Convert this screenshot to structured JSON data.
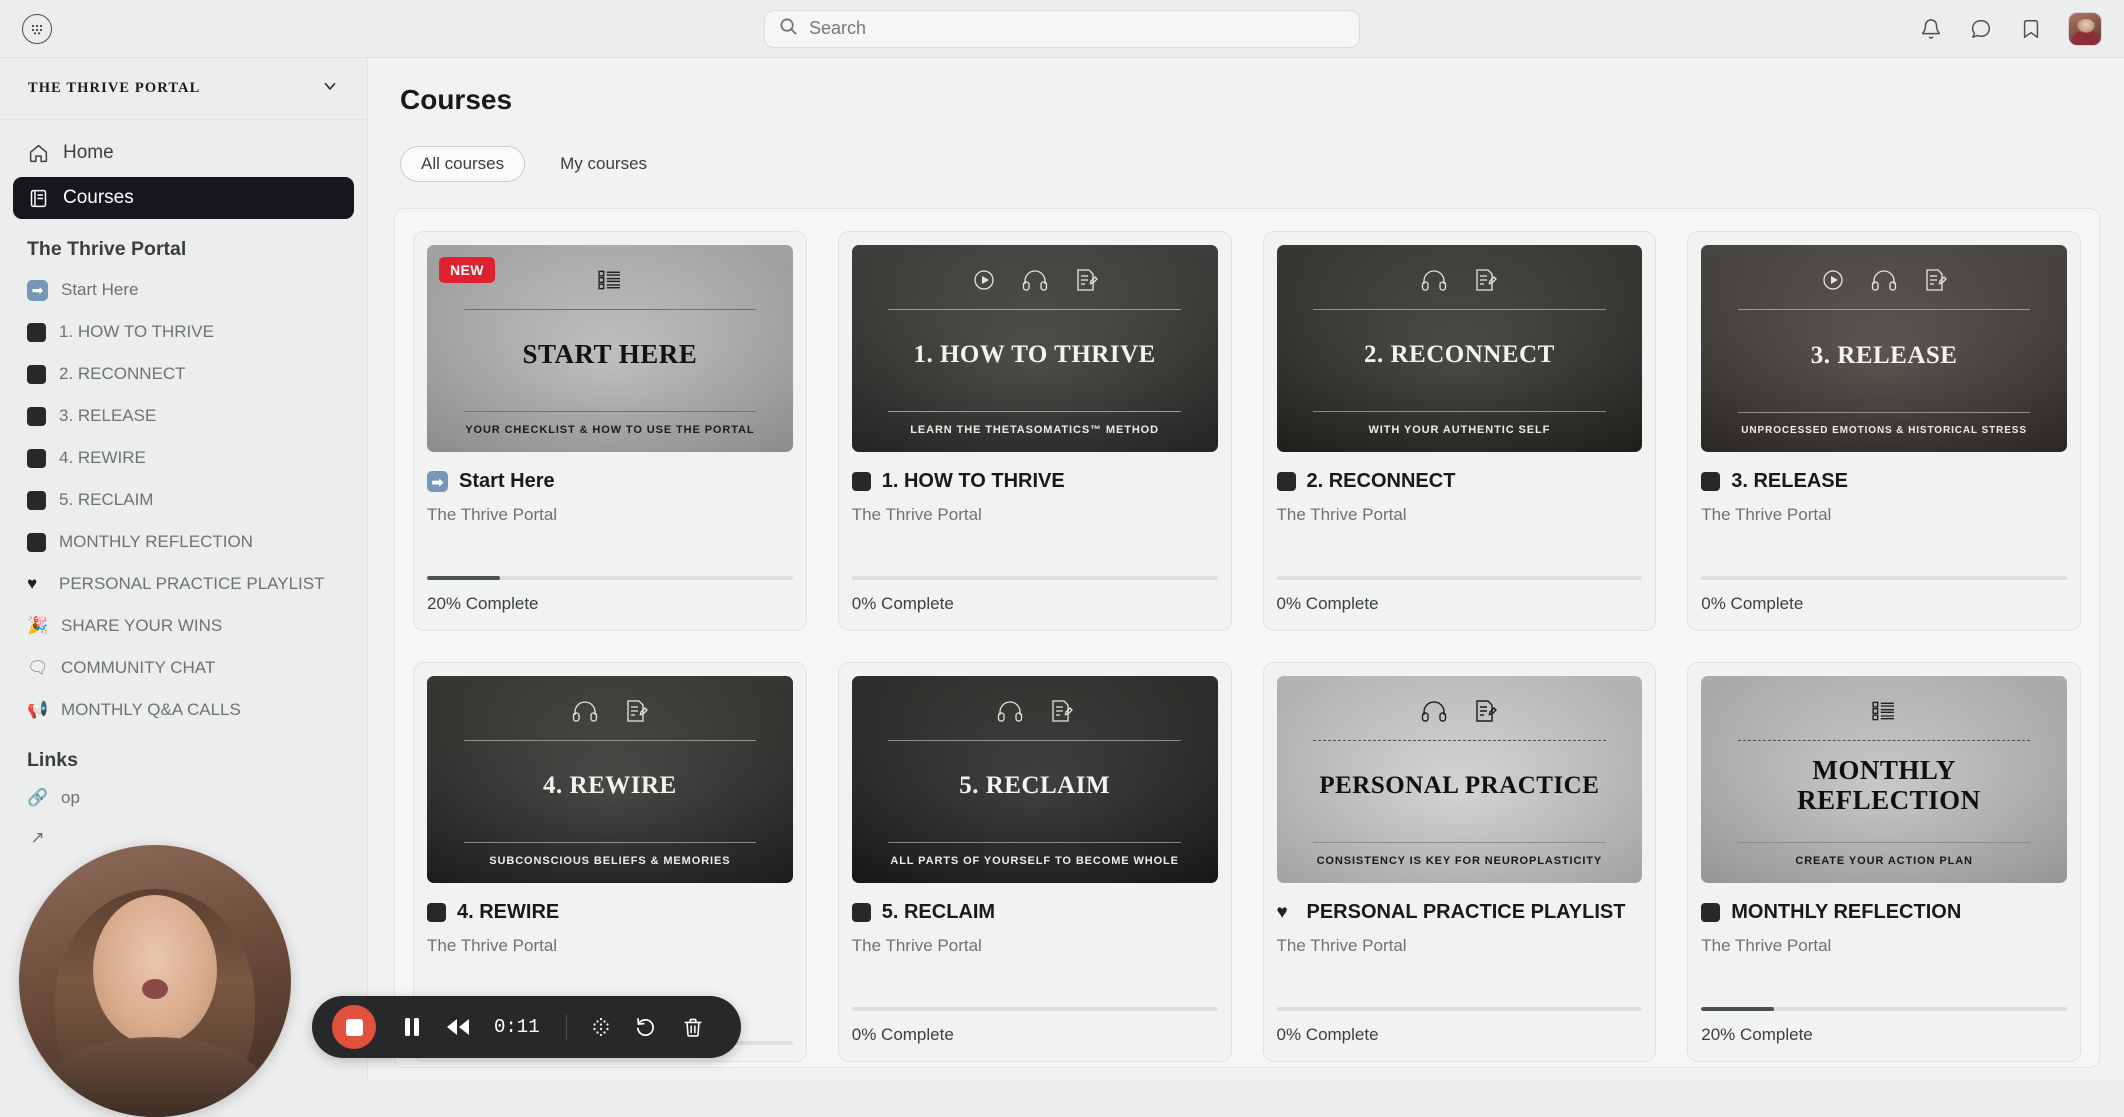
{
  "topbar": {
    "apps_icon": "apps-grid-icon",
    "search": {
      "placeholder": "Search",
      "value": ""
    },
    "icons": [
      "bell-icon",
      "chat-bubble-icon",
      "bookmark-icon"
    ],
    "avatar": "user-avatar"
  },
  "sidebar": {
    "workspace": {
      "name": "THE THRIVE PORTAL",
      "chevron": "chevron-down-icon"
    },
    "nav": [
      {
        "label": "Home",
        "icon": "home-icon",
        "active": false
      },
      {
        "label": "Courses",
        "icon": "courses-icon",
        "active": true
      }
    ],
    "section_label": "The Thrive Portal",
    "courses": [
      {
        "label": "Start Here",
        "icon": "arrow-right-emoji"
      },
      {
        "label": "1. HOW TO THRIVE",
        "icon": "black-square-emoji"
      },
      {
        "label": "2. RECONNECT",
        "icon": "black-square-emoji"
      },
      {
        "label": "3. RELEASE",
        "icon": "black-square-emoji"
      },
      {
        "label": "4. REWIRE",
        "icon": "black-square-emoji"
      },
      {
        "label": "5. RECLAIM",
        "icon": "black-square-emoji"
      },
      {
        "label": "MONTHLY REFLECTION",
        "icon": "black-square-emoji"
      },
      {
        "label": "PERSONAL PRACTICE PLAYLIST",
        "icon": "black-heart-emoji"
      },
      {
        "label": "SHARE YOUR WINS",
        "icon": "party-popper-emoji"
      },
      {
        "label": "COMMUNITY CHAT",
        "icon": "speech-balloon-emoji"
      },
      {
        "label": "MONTHLY Q&A CALLS",
        "icon": "loudspeaker-emoji"
      }
    ],
    "links_label": "Links",
    "links": [
      {
        "label": "op",
        "icon": "link-icon"
      },
      {
        "label": "",
        "icon": "external-link-icon"
      }
    ]
  },
  "main": {
    "title": "Courses",
    "tabs": [
      {
        "label": "All courses",
        "selected": true
      },
      {
        "label": "My courses",
        "selected": false
      }
    ],
    "cards": [
      {
        "badge": "NEW",
        "thumb_title": "START HERE",
        "thumb_sub": "YOUR CHECKLIST & HOW TO USE THE PORTAL",
        "thumb_icons": [
          "checklist-icon"
        ],
        "title": "Start Here",
        "title_icon": "arrow-right-emoji",
        "subtitle": "The Thrive Portal",
        "progress": 20,
        "progress_label": "20% Complete",
        "theme": "light"
      },
      {
        "badge": "",
        "thumb_title": "1. HOW TO THRIVE",
        "thumb_sub": "LEARN THE THETASOMATICS™ METHOD",
        "thumb_icons": [
          "play-circle-icon",
          "headphones-icon",
          "notes-pencil-icon"
        ],
        "title": "1. HOW TO THRIVE",
        "title_icon": "black-square-emoji",
        "subtitle": "The Thrive Portal",
        "progress": 0,
        "progress_label": "0% Complete",
        "theme": "dark"
      },
      {
        "badge": "",
        "thumb_title": "2. RECONNECT",
        "thumb_sub": "WITH YOUR AUTHENTIC SELF",
        "thumb_icons": [
          "headphones-icon",
          "notes-pencil-icon"
        ],
        "title": "2. RECONNECT",
        "title_icon": "black-square-emoji",
        "subtitle": "The Thrive Portal",
        "progress": 0,
        "progress_label": "0% Complete",
        "theme": "dark"
      },
      {
        "badge": "",
        "thumb_title": "3. RELEASE",
        "thumb_sub": "UNPROCESSED EMOTIONS & HISTORICAL STRESS",
        "thumb_icons": [
          "play-circle-icon",
          "headphones-icon",
          "notes-pencil-icon"
        ],
        "title": "3. RELEASE",
        "title_icon": "black-square-emoji",
        "subtitle": "The Thrive Portal",
        "progress": 0,
        "progress_label": "0% Complete",
        "theme": "dark"
      },
      {
        "badge": "",
        "thumb_title": "4. REWIRE",
        "thumb_sub": "SUBCONSCIOUS BELIEFS & MEMORIES",
        "thumb_icons": [
          "headphones-icon",
          "notes-pencil-icon"
        ],
        "title": "4. REWIRE",
        "title_icon": "black-square-emoji",
        "subtitle": "The Thrive Portal",
        "progress": 0,
        "progress_label": "",
        "theme": "dark"
      },
      {
        "badge": "",
        "thumb_title": "5. RECLAIM",
        "thumb_sub": "ALL PARTS OF YOURSELF TO BECOME WHOLE",
        "thumb_icons": [
          "headphones-icon",
          "notes-pencil-icon"
        ],
        "title": "5. RECLAIM",
        "title_icon": "black-square-emoji",
        "subtitle": "The Thrive Portal",
        "progress": 0,
        "progress_label": "0% Complete",
        "theme": "dark"
      },
      {
        "badge": "",
        "thumb_title": "PERSONAL PRACTICE",
        "thumb_sub": "CONSISTENCY IS KEY FOR NEUROPLASTICITY",
        "thumb_icons": [
          "headphones-icon",
          "notes-pencil-icon"
        ],
        "title": "PERSONAL PRACTICE PLAYLIST",
        "title_icon": "black-heart-emoji",
        "subtitle": "The Thrive Portal",
        "progress": 0,
        "progress_label": "0% Complete",
        "theme": "light"
      },
      {
        "badge": "",
        "thumb_title": "MONTHLY REFLECTION",
        "thumb_sub": "CREATE YOUR ACTION PLAN",
        "thumb_icons": [
          "checklist-icon"
        ],
        "title": "MONTHLY REFLECTION",
        "title_icon": "black-square-emoji",
        "subtitle": "The Thrive Portal",
        "progress": 20,
        "progress_label": "20% Complete",
        "theme": "light"
      }
    ]
  },
  "recorder": {
    "time": "0:11",
    "buttons": [
      "stop-recording-button",
      "pause-button",
      "rewind-button",
      "time-display",
      "blur-dots-button",
      "restart-button",
      "delete-button"
    ]
  },
  "colors": {
    "accent_red": "#e0212f",
    "stop_red": "#e2503e",
    "active_nav": "#15171a",
    "page_bg": "#f1f2f2",
    "sidebar_bg": "#eceded"
  }
}
